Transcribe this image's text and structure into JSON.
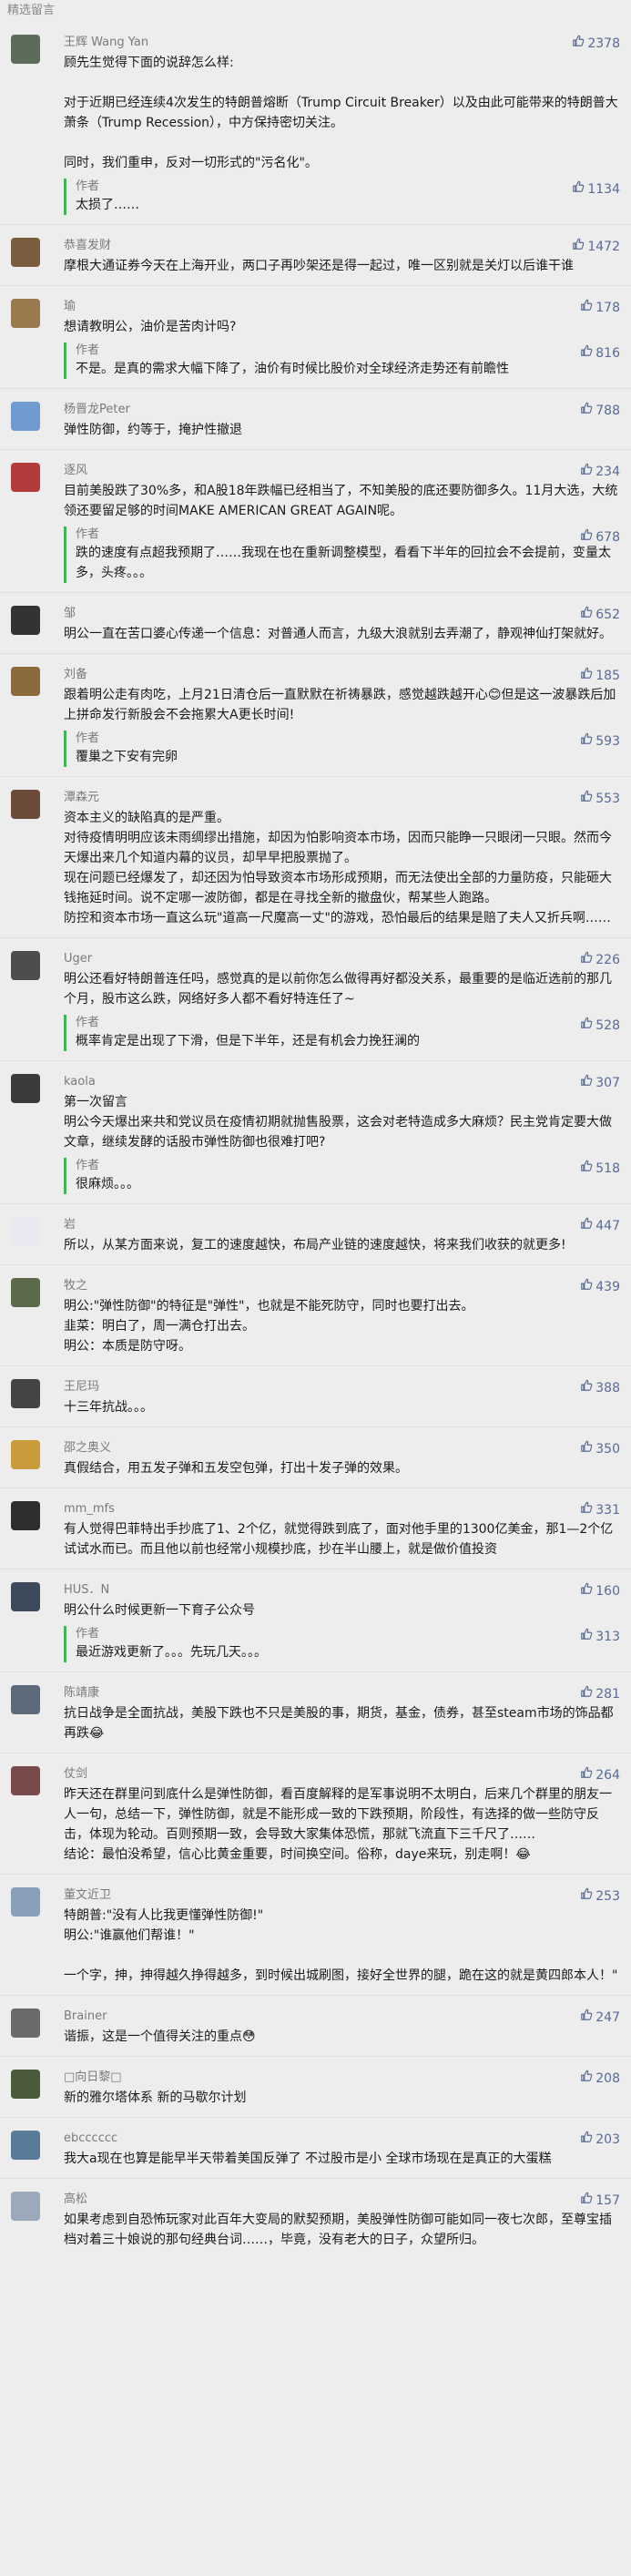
{
  "header": {
    "title": "精选留言"
  },
  "like_icon": "thumbs-up-icon",
  "colors": {
    "like": "#576b95",
    "reply_bar": "#46b25a",
    "name": "#7a7a7a"
  },
  "comments": [
    {
      "name": "王辉 Wang Yan",
      "likes": "2378",
      "avatar_color": "#5d6b5a",
      "text": "顾先生觉得下面的说辞怎么样:\n\n对于近期已经连续4次发生的特朗普熔断（Trump Circuit Breaker）以及由此可能带来的特朗普大萧条（Trump Recession），中方保持密切关注。\n\n同时，我们重申，反对一切形式的\"污名化\"。",
      "reply": {
        "author": "作者",
        "likes": "1134",
        "text": "太损了……"
      }
    },
    {
      "name": "恭喜发财",
      "likes": "1472",
      "avatar_color": "#7a5c3e",
      "text": "摩根大通证券今天在上海开业，两口子再吵架还是得一起过，唯一区别就是关灯以后谁干谁"
    },
    {
      "name": "瑜",
      "likes": "178",
      "avatar_color": "#9b7a4f",
      "text": "想请教明公，油价是苦肉计吗?",
      "reply": {
        "author": "作者",
        "likes": "816",
        "text": "不是。是真的需求大幅下降了，油价有时候比股价对全球经济走势还有前瞻性"
      }
    },
    {
      "name": "杨晋龙Peter",
      "likes": "788",
      "avatar_color": "#6f9bd1",
      "text": "弹性防御，约等于，掩护性撤退"
    },
    {
      "name": "逐风",
      "likes": "234",
      "avatar_color": "#b23b3b",
      "text": "目前美股跌了30%多，和A股18年跌幅已经相当了，不知美股的底还要防御多久。11月大选，大统领还要留足够的时间MAKE AMERICAN GREAT AGAIN呢。",
      "reply": {
        "author": "作者",
        "likes": "678",
        "text": "跌的速度有点超我预期了……我现在也在重新调整模型，看看下半年的回拉会不会提前，变量太多，头疼。。。"
      }
    },
    {
      "name": "邹",
      "likes": "652",
      "avatar_color": "#333333",
      "text": "明公一直在苦口婆心传递一个信息：对普通人而言，九级大浪就别去弄潮了，静观神仙打架就好。"
    },
    {
      "name": "刘备",
      "likes": "185",
      "avatar_color": "#8a6a3c",
      "text": "跟着明公走有肉吃，上月21日清仓后一直默默在祈祷暴跌，感觉越跌越开心😊但是这一波暴跌后加上拼命发行新股会不会拖累大A更长时间!",
      "reply": {
        "author": "作者",
        "likes": "593",
        "text": "覆巢之下安有完卵"
      }
    },
    {
      "name": "潭森元",
      "likes": "553",
      "avatar_color": "#6b4a3a",
      "text": "资本主义的缺陷真的是严重。\n对待疫情明明应该未雨绸缪出措施，却因为怕影响资本市场，因而只能睁一只眼闭一只眼。然而今天爆出来几个知道内幕的议员，却早早把股票抛了。\n现在问题已经爆发了，却还因为怕导致资本市场形成预期，而无法使出全部的力量防疫，只能砸大钱拖延时间。说不定哪一波防御，都是在寻找全新的撤盘伙，帮某些人跑路。\n防控和资本市场一直这么玩\"道高一尺魔高一丈\"的游戏，恐怕最后的结果是赔了夫人又折兵啊……"
    },
    {
      "name": "Uger",
      "likes": "226",
      "avatar_color": "#4d4d4d",
      "text": "明公还看好特朗普连任吗，感觉真的是以前你怎么做得再好都没关系，最重要的是临近选前的那几个月，股市这么跌，网络好多人都不看好特连任了~",
      "reply": {
        "author": "作者",
        "likes": "528",
        "text": "概率肯定是出现了下滑，但是下半年，还是有机会力挽狂澜的"
      }
    },
    {
      "name": "kaola",
      "likes": "307",
      "avatar_color": "#3a3a3a",
      "text": "第一次留言\n明公今天爆出来共和党议员在疫情初期就抛售股票，这会对老特造成多大麻烦？民主党肯定要大做文章，继续发酵的话股市弹性防御也很难打吧?",
      "reply": {
        "author": "作者",
        "likes": "518",
        "text": "很麻烦。。。"
      }
    },
    {
      "name": "岩",
      "likes": "447",
      "avatar_color": "#e8e8f0",
      "text": "所以，从某方面来说，复工的速度越快，布局产业链的速度越快，将来我们收获的就更多!"
    },
    {
      "name": "牧之",
      "likes": "439",
      "avatar_color": "#5a6a4a",
      "text": "明公:\"弹性防御\"的特征是\"弹性\"，也就是不能死防守，同时也要打出去。\n韭菜：明白了，周一满仓打出去。\n明公：本质是防守呀。"
    },
    {
      "name": "王尼玛",
      "likes": "388",
      "avatar_color": "#444444",
      "text": "十三年抗战。。。"
    },
    {
      "name": "邵之奥义",
      "likes": "350",
      "avatar_color": "#c89c3a",
      "text": "真假结合，用五发子弹和五发空包弹，打出十发子弹的效果。"
    },
    {
      "name": "mm_mfs",
      "likes": "331",
      "avatar_color": "#2f2f2f",
      "text": "有人觉得巴菲特出手抄底了1、2个亿，就觉得跌到底了，面对他手里的1300亿美金，那1—2个亿试试水而已。而且他以前也经常小规模抄底，抄在半山腰上，就是做价值投资"
    },
    {
      "name": "HUS．N",
      "likes": "160",
      "avatar_color": "#3d4a5c",
      "text": "明公什么时候更新一下育子公众号",
      "reply": {
        "author": "作者",
        "likes": "313",
        "text": "最近游戏更新了。。。先玩几天。。。"
      }
    },
    {
      "name": "陈靖康",
      "likes": "281",
      "avatar_color": "#5c6a7a",
      "text": "抗日战争是全面抗战，美股下跌也不只是美股的事，期货，基金，债券，甚至steam市场的饰品都再跌😂"
    },
    {
      "name": "仗剑",
      "likes": "264",
      "avatar_color": "#7a4a4a",
      "text": "昨天还在群里问到底什么是弹性防御，看百度解释的是军事说明不太明白，后来几个群里的朋友一人一句，总结一下，弹性防御，就是不能形成一致的下跌预期，阶段性，有选择的做一些防守反击，体现为轮动。百则预期一致，会导致大家集体恐慌，那就飞流直下三千尺了……\n结论：最怕没希望，信心比黄金重要，时间换空间。俗称，daye来玩，别走啊！😂"
    },
    {
      "name": "董文近卫",
      "likes": "253",
      "avatar_color": "#8aa0b8",
      "text": "特朗普:\"没有人比我更懂弹性防御!\"\n明公:\"谁赢他们帮谁！\"\n\n一个字，抻，抻得越久挣得越多，到时候出城刷图，接好全世界的腿，跪在这的就是黄四郎本人！\""
    },
    {
      "name": "Brainer",
      "likes": "247",
      "avatar_color": "#6a6a6a",
      "text": "谐振，这是一个值得关注的重点😳"
    },
    {
      "name": "□向日黎□",
      "likes": "208",
      "avatar_color": "#4a5a3a",
      "text": "新的雅尔塔体系 新的马歇尔计划"
    },
    {
      "name": "ebcccccc",
      "likes": "203",
      "avatar_color": "#5a7a9a",
      "text": "我大a现在也算是能早半天带着美国反弹了 不过股市是小 全球市场现在是真正的大蛋糕"
    },
    {
      "name": "高松",
      "likes": "157",
      "avatar_color": "#9aaabb",
      "text": "如果考虑到自恐怖玩家对此百年大变局的默契预期，美股弹性防御可能如同一夜七次郎，至尊宝插档对着三十娘说的那句经典台词……，毕竟，没有老大的日子，众望所归。"
    }
  ]
}
